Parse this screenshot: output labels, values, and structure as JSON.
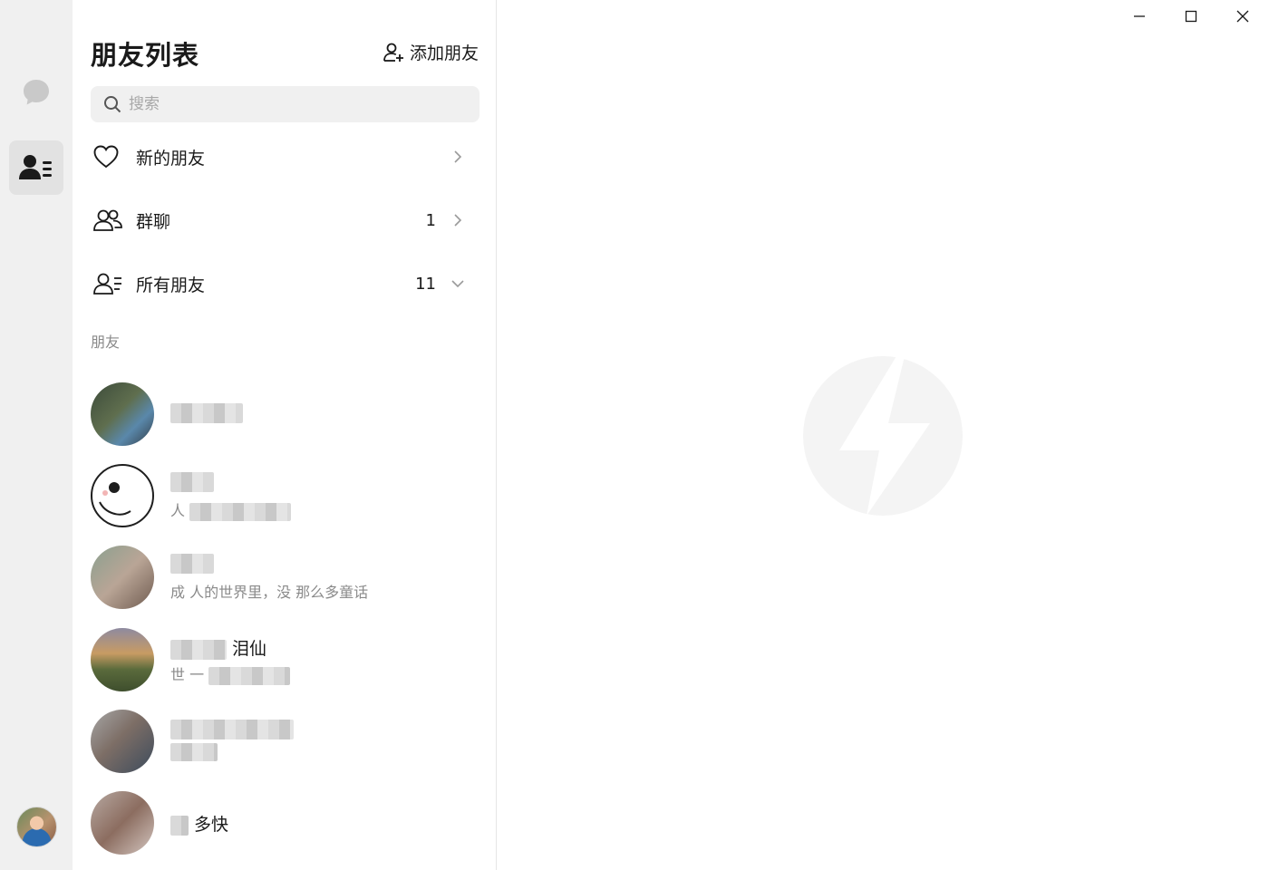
{
  "panel": {
    "title": "朋友列表",
    "add_friend_label": "添加朋友",
    "search_placeholder": "搜索"
  },
  "menu": [
    {
      "label": "新的朋友",
      "count": "",
      "icon": "heart-icon",
      "chevron": "chevron-right-icon"
    },
    {
      "label": "群聊",
      "count": "1",
      "icon": "group-icon",
      "chevron": "chevron-right-icon"
    },
    {
      "label": "所有朋友",
      "count": "11",
      "icon": "contacts-list-icon",
      "chevron": "chevron-down-icon"
    }
  ],
  "section_label": "朋友",
  "friends": [
    {
      "name_visible": "",
      "signature_visible": ""
    },
    {
      "name_visible": "",
      "signature_visible": "人"
    },
    {
      "name_visible": "",
      "signature_visible": "成 人的世界里，没 那么多童话"
    },
    {
      "name_visible": "泪仙",
      "signature_visible": "世 一"
    },
    {
      "name_visible": "",
      "signature_visible": ""
    },
    {
      "name_visible": "多快",
      "signature_visible": ""
    }
  ],
  "rail": {
    "icons": [
      "chat-bubble-icon",
      "contacts-icon"
    ],
    "active": "contacts"
  },
  "window_controls": [
    "minimize-icon",
    "maximize-icon",
    "close-icon"
  ],
  "colors": {
    "rail_bg": "#f0f0f0",
    "rail_active": "#e2e2e2",
    "search_bg": "#f0f0f0",
    "muted_text": "#8a8a8a",
    "logo_fill": "#f4f4f4"
  }
}
